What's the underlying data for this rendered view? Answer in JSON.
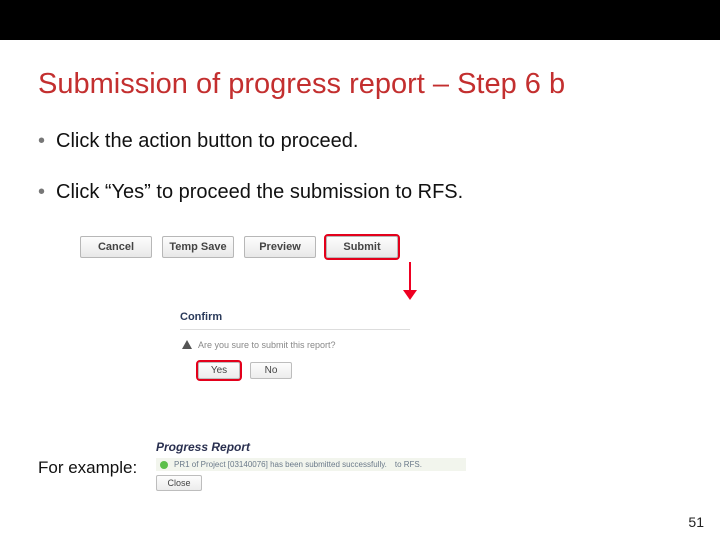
{
  "title": "Submission of progress report – Step 6 b",
  "bullets": [
    "Click the action button to proceed.",
    "Click “Yes” to proceed the submission to RFS."
  ],
  "buttons": {
    "cancel": "Cancel",
    "temp_save": "Temp Save",
    "preview": "Preview",
    "submit": "Submit"
  },
  "confirm": {
    "title": "Confirm",
    "message": "Are you sure to submit this report?",
    "yes": "Yes",
    "no": "No"
  },
  "example": {
    "label": "For example:",
    "heading": "Progress Report",
    "message": "PR1 of Project [03140076] has been submitted successfully.",
    "tail": "to RFS.",
    "close": "Close"
  },
  "page_number": "51"
}
